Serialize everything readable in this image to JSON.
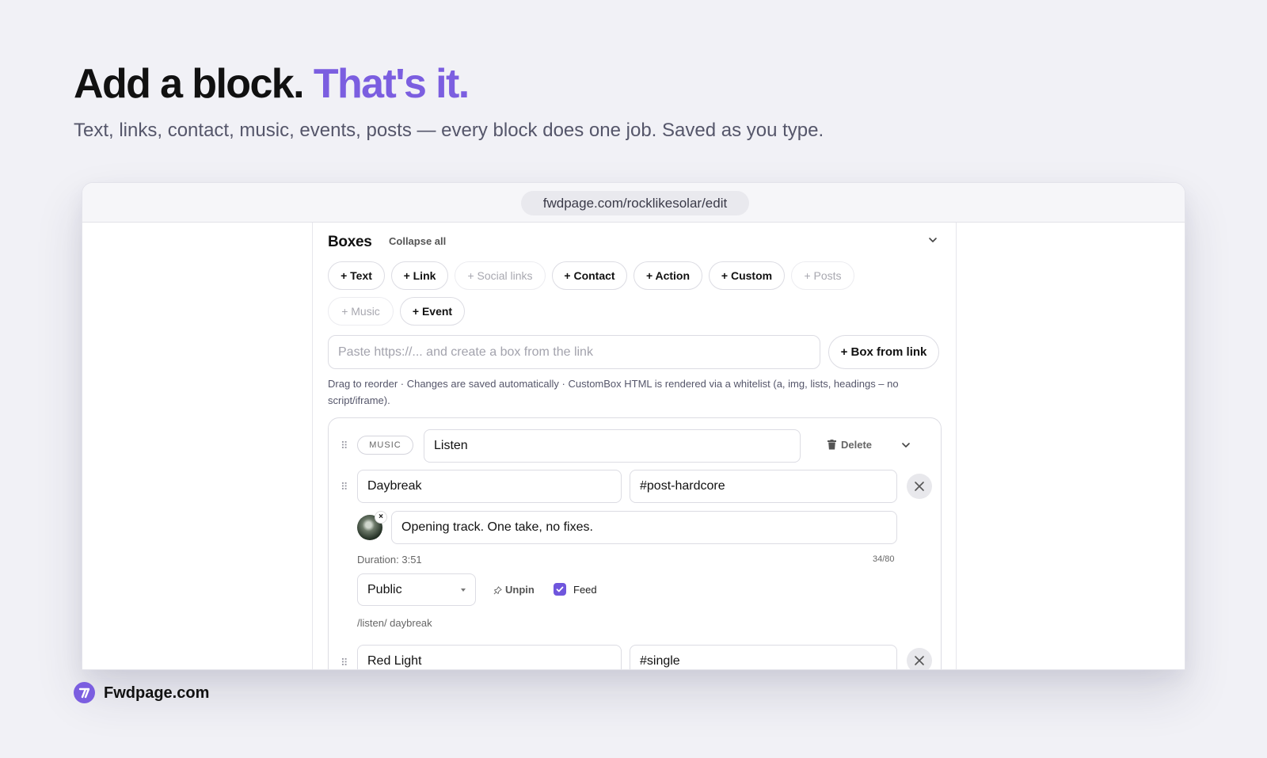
{
  "hero": {
    "title_main": "Add a block.",
    "title_accent": "That's it.",
    "subtitle": "Text, links, contact, music, events, posts — every block does one job. Saved as you type."
  },
  "browser": {
    "url": "fwdpage.com/rocklikesolar/edit"
  },
  "editor": {
    "title": "Boxes",
    "collapse_all": "Collapse all",
    "chips": [
      {
        "label": "+ Text",
        "enabled": true
      },
      {
        "label": "+ Link",
        "enabled": true
      },
      {
        "label": "+ Social links",
        "enabled": false
      },
      {
        "label": "+ Contact",
        "enabled": true
      },
      {
        "label": "+ Action",
        "enabled": true
      },
      {
        "label": "+ Custom",
        "enabled": true
      },
      {
        "label": "+ Posts",
        "enabled": false
      },
      {
        "label": "+ Music",
        "enabled": false
      },
      {
        "label": "+ Event",
        "enabled": true
      }
    ],
    "link_placeholder": "Paste https://... and create a box from the link",
    "box_from_link": "+ Box from link",
    "hint": "Drag to reorder · Changes are saved automatically · CustomBox HTML is rendered via a whitelist (a, img, lists, headings – no script/iframe)."
  },
  "music_box": {
    "type_badge": "MUSIC",
    "title": "Listen",
    "delete_label": "Delete",
    "tracks": [
      {
        "name": "Daybreak",
        "tag": "#post-hardcore",
        "description": "Opening track. One take, no fixes.",
        "duration": "Duration: 3:51",
        "char_count": "34/80",
        "visibility": "Public",
        "unpin_label": "Unpin",
        "feed_label": "Feed",
        "feed_checked": true,
        "path": "/listen/ daybreak"
      },
      {
        "name": "Red Light",
        "tag": "#single"
      }
    ]
  },
  "footer": {
    "brand": "Fwdpage.com"
  },
  "colors": {
    "accent": "#7b5ee0",
    "checkbox": "#6f56dd",
    "background": "#f1f1f6"
  }
}
